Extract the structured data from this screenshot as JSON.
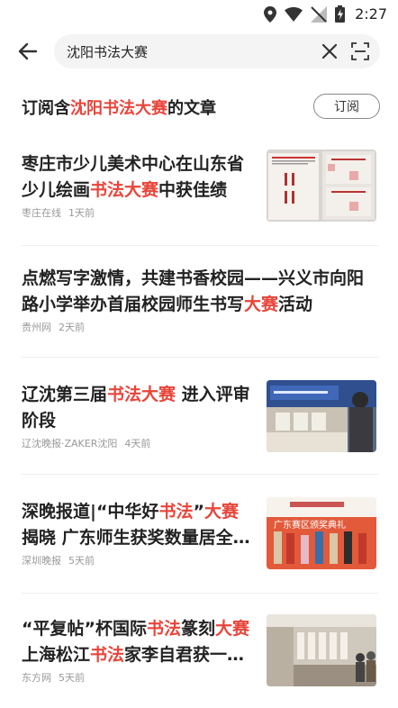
{
  "status_bar": {
    "time": "2:27",
    "icons": [
      "location-icon",
      "wifi-icon",
      "signal-off-icon",
      "battery-charging-icon"
    ]
  },
  "search": {
    "query": "沈阳书法大赛",
    "back_icon": "arrow-left-icon",
    "clear_icon": "close-icon",
    "scan_icon": "scan-icon"
  },
  "subscribe": {
    "prefix": "订阅含",
    "keyword": "沈阳书法大赛",
    "suffix": "的文章",
    "button_label": "订阅"
  },
  "articles": [
    {
      "title_parts": [
        "枣庄市少儿美术中心在山东省少儿绘画",
        "书法大赛",
        "中获佳绩"
      ],
      "source": "枣庄在线",
      "time": "1天前",
      "has_thumb": true
    },
    {
      "title_parts": [
        "点燃写字激情，共建书香校园——兴义市向阳路小学举办首届校园师生书写",
        "大赛",
        "活动"
      ],
      "source": "贵州网",
      "time": "2天前",
      "has_thumb": false
    },
    {
      "title_parts": [
        "辽沈第三届",
        "书法大赛",
        " 进入评审阶段"
      ],
      "source": "辽沈晚报·ZAKER沈阳",
      "time": "4天前",
      "has_thumb": true
    },
    {
      "title_parts": [
        "深晚报道|“中华好",
        "书法",
        "”",
        "大赛",
        "揭晓 广东师生获奖数量居全国前列"
      ],
      "source": "深圳晚报",
      "time": "5天前",
      "has_thumb": true,
      "thumb_text": "广东赛区颁奖典礼"
    },
    {
      "title_parts": [
        "“平复帖”杯国际",
        "书法",
        "篆刻",
        "大赛",
        "上海松江",
        "书法",
        "家李自君获一等奖"
      ],
      "source": "东方网",
      "time": "5天前",
      "has_thumb": true
    }
  ],
  "colors": {
    "highlight": "#e8453a",
    "text": "#222222",
    "meta": "#999999",
    "search_bg": "#f4f4f4"
  }
}
